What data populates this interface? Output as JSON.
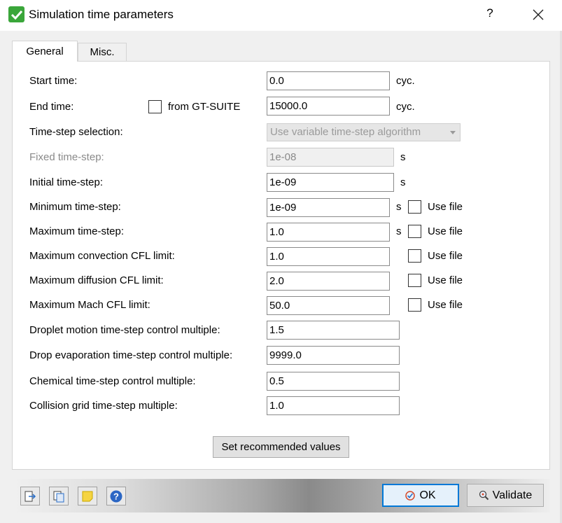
{
  "window": {
    "title": "Simulation time parameters",
    "help_label": "?",
    "close_label": "×"
  },
  "tabs": [
    {
      "label": "General",
      "active": true
    },
    {
      "label": "Misc.",
      "active": false
    }
  ],
  "fields": {
    "start_time": {
      "label": "Start time:",
      "value": "0.0",
      "unit": "cyc."
    },
    "end_time": {
      "label": "End time:",
      "value": "15000.0",
      "unit": "cyc.",
      "checkbox_label": "from GT-SUITE"
    },
    "time_step_selection": {
      "label": "Time-step selection:",
      "value": "Use variable time-step algorithm"
    },
    "fixed_time_step": {
      "label": "Fixed time-step:",
      "value": "1e-08",
      "unit": "s"
    },
    "initial_time_step": {
      "label": "Initial time-step:",
      "value": "1e-09",
      "unit": "s"
    },
    "minimum_time_step": {
      "label": "Minimum time-step:",
      "value": "1e-09",
      "unit": "s",
      "checkbox_label": "Use file"
    },
    "maximum_time_step": {
      "label": "Maximum time-step:",
      "value": "1.0",
      "unit": "s",
      "checkbox_label": "Use file"
    },
    "max_convection_cfl": {
      "label": "Maximum convection CFL limit:",
      "value": "1.0",
      "checkbox_label": "Use file"
    },
    "max_diffusion_cfl": {
      "label": "Maximum diffusion CFL limit:",
      "value": "2.0",
      "checkbox_label": "Use file"
    },
    "max_mach_cfl": {
      "label": "Maximum Mach CFL limit:",
      "value": "50.0",
      "checkbox_label": "Use file"
    },
    "droplet_motion": {
      "label": "Droplet motion time-step control multiple:",
      "value": "1.5"
    },
    "drop_evaporation": {
      "label": "Drop evaporation time-step control multiple:",
      "value": "9999.0"
    },
    "chemical": {
      "label": "Chemical time-step control multiple:",
      "value": "0.5"
    },
    "collision_grid": {
      "label": "Collision grid time-step multiple:",
      "value": "1.0"
    }
  },
  "buttons": {
    "recommended": "Set recommended values",
    "ok": "OK",
    "validate": "Validate"
  },
  "icons": {
    "title": "green-check-icon",
    "footer": [
      "export-icon",
      "copy-icon",
      "note-icon",
      "help-icon"
    ]
  },
  "colors": {
    "accent": "#0078d7",
    "title_check": "#3aa63a"
  }
}
